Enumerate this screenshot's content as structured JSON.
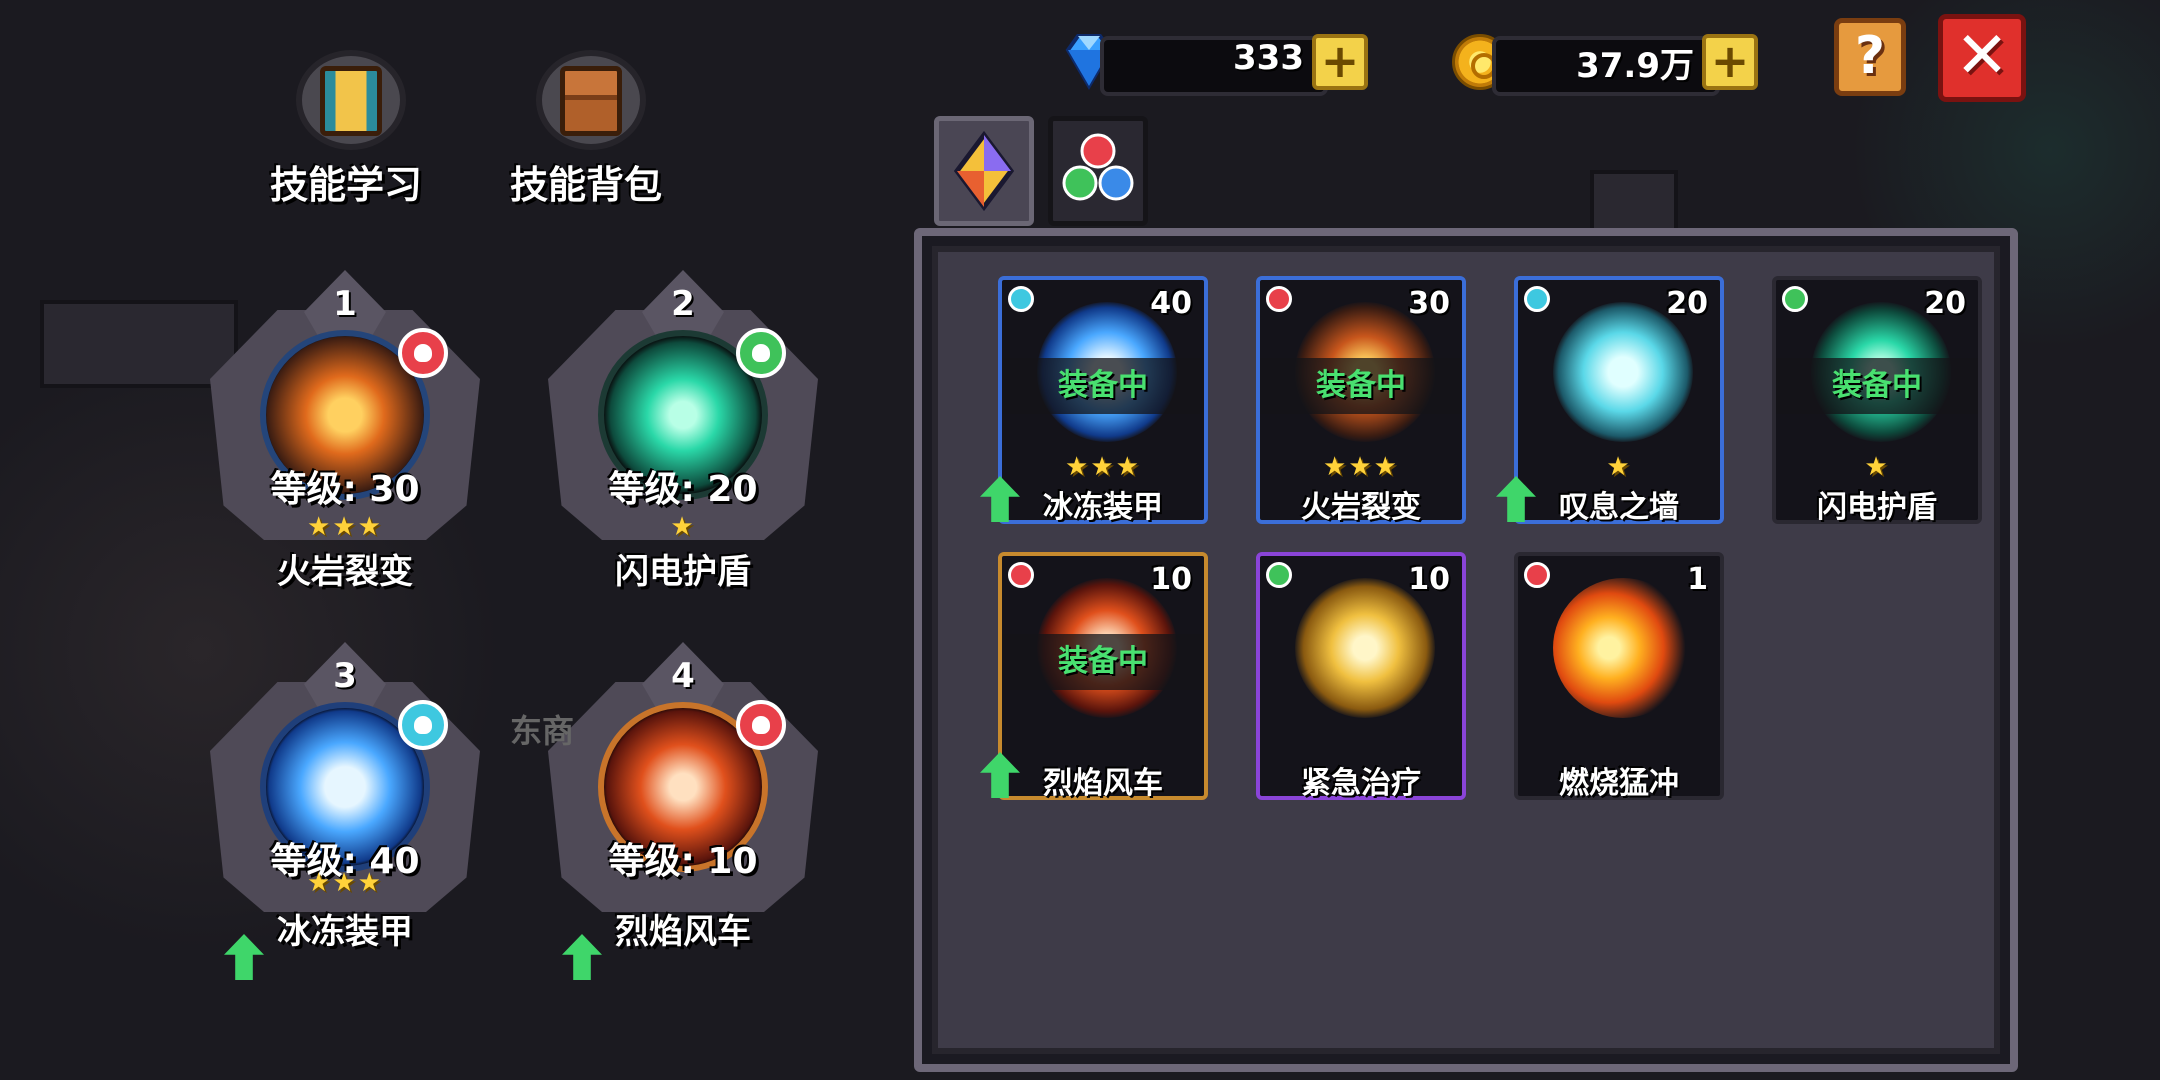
{
  "currency": {
    "gems": "333",
    "gold": "37.9万",
    "plus_label": "+"
  },
  "buttons": {
    "help_label": "?",
    "close_label": "✕"
  },
  "menu": {
    "skill_learn": "技能学习",
    "skill_bag": "技能背包"
  },
  "equipped": [
    {
      "slot": "1",
      "level": "等级: 30",
      "stars": "★★★",
      "name": "火岩裂变",
      "element": "fire",
      "upgrade": false
    },
    {
      "slot": "2",
      "level": "等级: 20",
      "stars": "★",
      "name": "闪电护盾",
      "element": "nature",
      "upgrade": false
    },
    {
      "slot": "3",
      "level": "等级: 40",
      "stars": "★★★",
      "name": "冰冻装甲",
      "element": "ice",
      "upgrade": true
    },
    {
      "slot": "4",
      "level": "等级: 10",
      "stars": "",
      "name": "烈焰风车",
      "element": "fire",
      "upgrade": true
    }
  ],
  "npc_text": "东商",
  "tabs": [
    "all-crystal",
    "elements"
  ],
  "inventory": [
    {
      "count": "40",
      "equipped_tag": "装备中",
      "stars": "★★★",
      "name": "冰冻装甲",
      "element": "ice",
      "upgrade": true,
      "rarity": "blue"
    },
    {
      "count": "30",
      "equipped_tag": "装备中",
      "stars": "★★★",
      "name": "火岩裂变",
      "element": "fire",
      "upgrade": false,
      "rarity": "blue"
    },
    {
      "count": "20",
      "equipped_tag": "",
      "stars": "★",
      "name": "叹息之墙",
      "element": "ice",
      "upgrade": true,
      "rarity": "blue"
    },
    {
      "count": "20",
      "equipped_tag": "装备中",
      "stars": "★",
      "name": "闪电护盾",
      "element": "nature",
      "upgrade": false,
      "rarity": "none"
    },
    {
      "count": "10",
      "equipped_tag": "装备中",
      "stars": "",
      "name": "烈焰风车",
      "element": "fire",
      "upgrade": true,
      "rarity": "gold"
    },
    {
      "count": "10",
      "equipped_tag": "",
      "stars": "",
      "name": "紧急治疗",
      "element": "nature",
      "upgrade": false,
      "rarity": "purple"
    },
    {
      "count": "1",
      "equipped_tag": "",
      "stars": "",
      "name": "燃烧猛冲",
      "element": "fire",
      "upgrade": false,
      "rarity": "none"
    }
  ],
  "colors": {
    "fire": "#e8404a",
    "nature": "#3fc25a",
    "ice": "#3ec8e0",
    "equipped_text": "#49e070",
    "star": "#ffd23a"
  }
}
